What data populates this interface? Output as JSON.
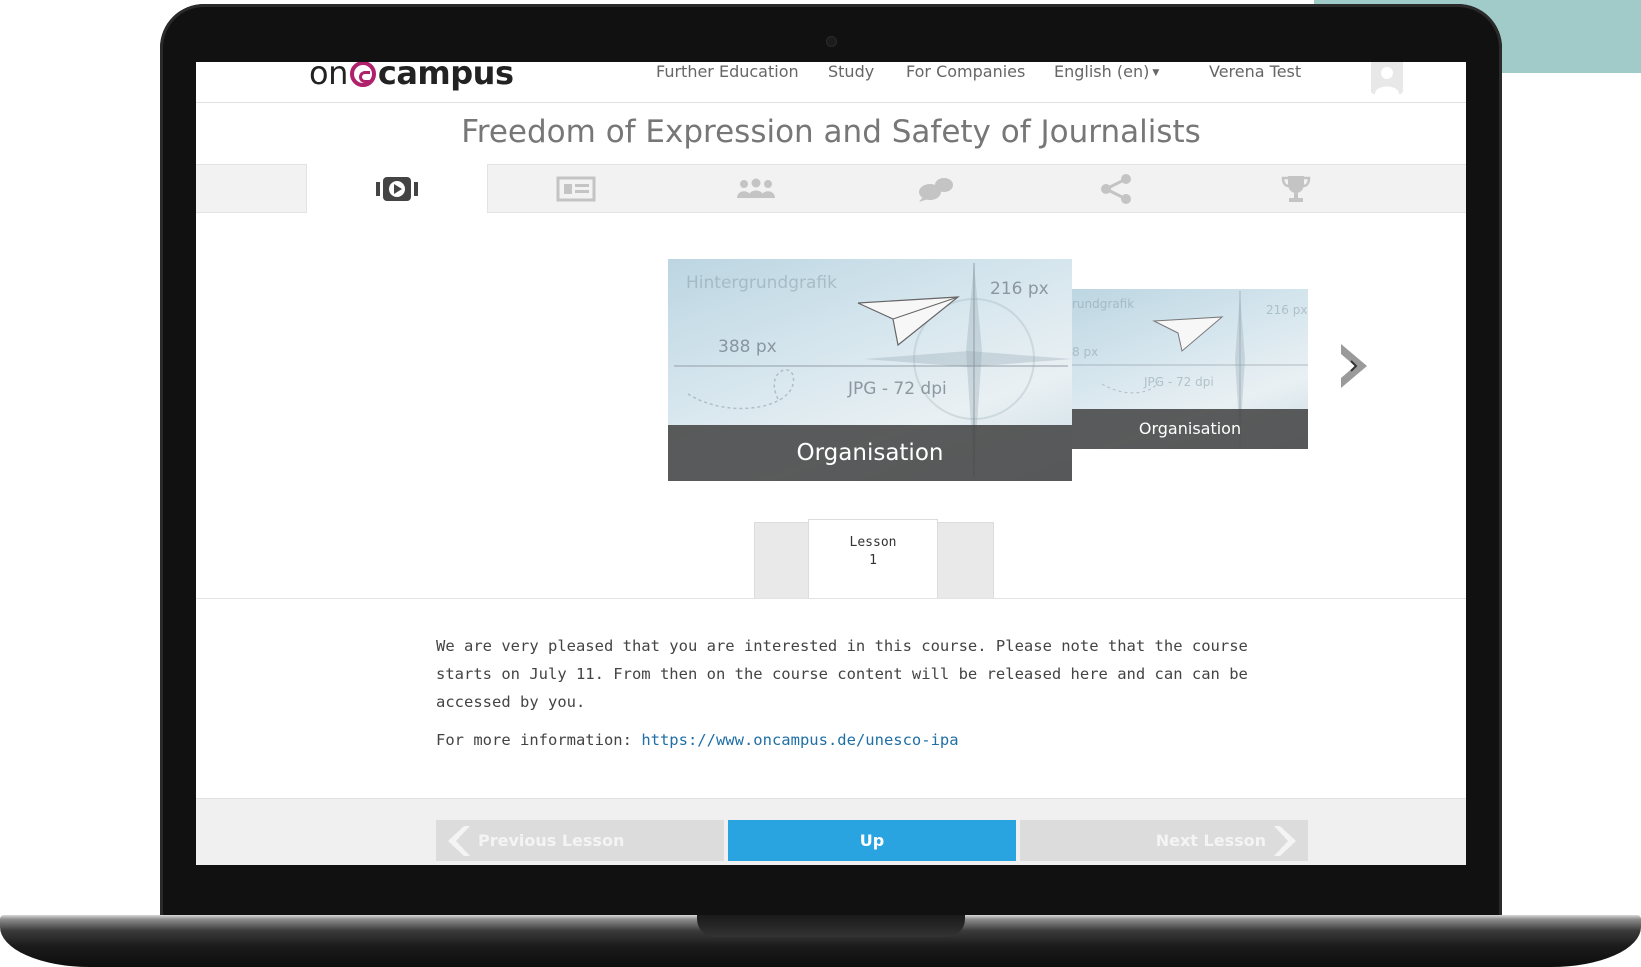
{
  "brand": {
    "logo_left": "on",
    "logo_right": "campus",
    "accent": "#b0216b"
  },
  "nav": {
    "items": [
      {
        "label": "Further Education"
      },
      {
        "label": "Study"
      },
      {
        "label": "For Companies"
      },
      {
        "label": "English (en)"
      }
    ],
    "user": "Verena Test"
  },
  "course": {
    "title": "Freedom of Expression and Safety of Journalists"
  },
  "tabs": [
    {
      "icon": "video-icon",
      "active": true
    },
    {
      "icon": "news-icon",
      "active": false
    },
    {
      "icon": "people-icon",
      "active": false
    },
    {
      "icon": "chat-icon",
      "active": false
    },
    {
      "icon": "share-icon",
      "active": false
    },
    {
      "icon": "trophy-icon",
      "active": false
    }
  ],
  "slider": {
    "main": {
      "caption": "Organisation",
      "watermark_title": "Hintergrundgrafik",
      "watermark_width": "388 px",
      "watermark_height": "216 px",
      "watermark_format": "JPG - 72 dpi"
    },
    "side": {
      "caption": "Organisation",
      "watermark_title": "rundgrafik",
      "watermark_width": "8 px",
      "watermark_height": "216 px",
      "watermark_format": "JPG - 72 dpi"
    }
  },
  "lesson": {
    "label": "Lesson",
    "number": "1"
  },
  "content": {
    "paragraph1": "We are very pleased that you are interested in this course. Please note that the course starts on July 11. From then on the course content will be released here and can can be accessed by you.",
    "more_info_label": "For more information: ",
    "more_info_link": "https://www.oncampus.de/unesco-ipa"
  },
  "footer": {
    "prev": "Previous Lesson",
    "up": "Up",
    "next": "Next Lesson",
    "up_color": "#2aa4e0"
  }
}
